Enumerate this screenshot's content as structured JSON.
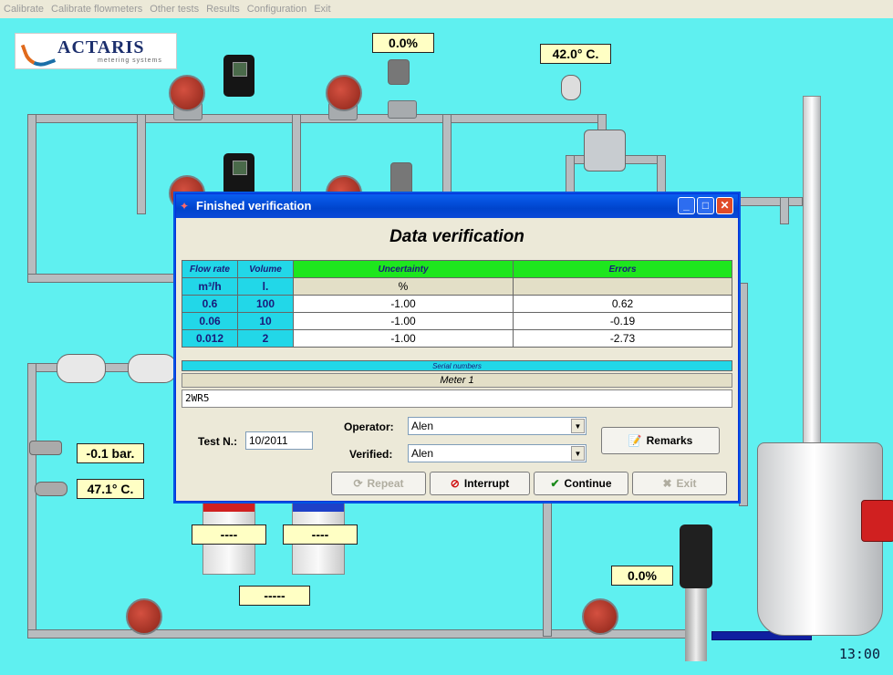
{
  "menu": [
    "Calibrate",
    "Calibrate flowmeters",
    "Other tests",
    "Results",
    "Configuration",
    "Exit"
  ],
  "logo": {
    "name": "ACTARIS",
    "tagline": "metering systems"
  },
  "readouts": {
    "valve_top": "0.0%",
    "temp_top": "42.0° C.",
    "pressure": "-0.1 bar.",
    "temp_left": "47.1° C.",
    "pump": "0.0%",
    "cab1": "----",
    "cab2": "----",
    "cab_bottom": "-----"
  },
  "clock": "13:00",
  "dialog": {
    "title": "Finished verification",
    "heading": "Data verification",
    "columns": [
      "Flow rate",
      "Volume",
      "Uncertainty",
      "Errors"
    ],
    "units": [
      "m³/h",
      "l.",
      "%",
      ""
    ],
    "rows": [
      {
        "flow": "0.6",
        "volume": "100",
        "uncertainty": "-1.00",
        "error": "0.62"
      },
      {
        "flow": "0.06",
        "volume": "10",
        "uncertainty": "-1.00",
        "error": "-0.19"
      },
      {
        "flow": "0.012",
        "volume": "2",
        "uncertainty": "-1.00",
        "error": "-2.73"
      }
    ],
    "serial_header": "Serial numbers",
    "meter_label": "Meter 1",
    "serial_value": "2WR5",
    "test_label": "Test N.:",
    "test_value": "10/2011",
    "operator_label": "Operator:",
    "operator_value": "Alen",
    "verified_label": "Verified:",
    "verified_value": "Alen",
    "remarks_label": "Remarks",
    "buttons": {
      "repeat": "Repeat",
      "interrupt": "Interrupt",
      "continue": "Continue",
      "exit": "Exit"
    }
  },
  "colors": {
    "background": "#5ff0f0",
    "header_cyan": "#22d7e8",
    "header_green": "#1ee61e"
  }
}
